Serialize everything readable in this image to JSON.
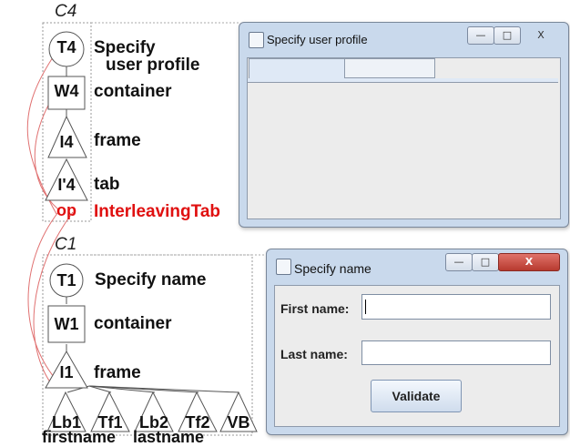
{
  "contexts": {
    "c4": "C4",
    "c1": "C1"
  },
  "tree_c4": {
    "t4": {
      "node": "T4",
      "label_line1": "Specify",
      "label_line2": "user profile"
    },
    "w4": {
      "node": "W4",
      "label": "container"
    },
    "i4": {
      "node": "I4",
      "label": "frame"
    },
    "i4p": {
      "node": "I'4",
      "label": "tab"
    },
    "op": {
      "node": "op",
      "label": "InterleavingTab"
    }
  },
  "tree_c1": {
    "t1": {
      "node": "T1",
      "label": "Specify name"
    },
    "w1": {
      "node": "W1",
      "label": "container"
    },
    "i1": {
      "node": "I1",
      "label": "frame"
    },
    "leaves": [
      {
        "node": "Lb1"
      },
      {
        "node": "Tf1"
      },
      {
        "node": "Lb2"
      },
      {
        "node": "Tf2"
      },
      {
        "node": "VB"
      }
    ],
    "leaf_captions": {
      "first": "firstname",
      "last": "lastname"
    }
  },
  "window_profile": {
    "title": "Specify user profile",
    "tabs": [
      "",
      ""
    ],
    "minimize": "—",
    "maximize": "□",
    "close": "X"
  },
  "window_name": {
    "title": "Specify name",
    "first_name_label": "First name:",
    "last_name_label": "Last name:",
    "first_name_value": "",
    "last_name_value": "",
    "validate_button": "Validate",
    "minimize": "—",
    "maximize": "□",
    "close": "X"
  },
  "colors": {
    "operator": "#e01010",
    "window_chrome": "#c9d9ec",
    "close_button": "#c8443a"
  }
}
